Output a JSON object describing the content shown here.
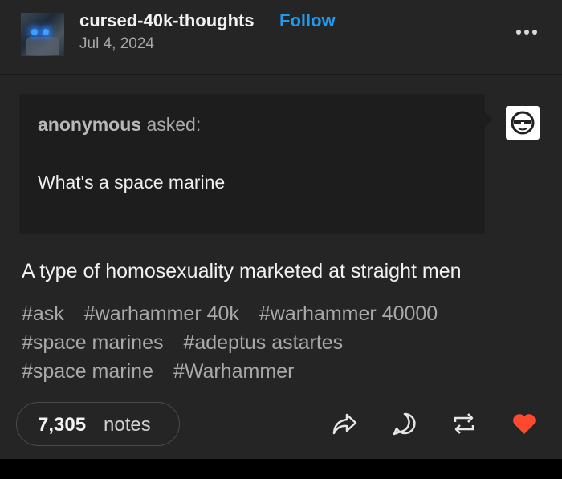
{
  "header": {
    "blog_name": "cursed-40k-thoughts",
    "follow_label": "Follow",
    "date": "Jul 4, 2024",
    "more_icon": "more-options-icon"
  },
  "ask": {
    "asker": "anonymous",
    "asked_suffix": " asked:",
    "question": "What's a space marine",
    "anon_avatar_icon": "anonymous-sunglasses-icon"
  },
  "answer": "A type of homosexuality marketed at straight men",
  "tags": [
    [
      "#ask",
      "#warhammer 40k",
      "#warhammer 40000"
    ],
    [
      "#space marines",
      "#adeptus astartes"
    ],
    [
      "#space marine",
      "#Warhammer"
    ]
  ],
  "footer": {
    "notes_count": "7,305",
    "notes_label": "notes",
    "actions": [
      "share-icon",
      "reply-icon",
      "reblog-icon",
      "like-icon"
    ]
  },
  "colors": {
    "background": "#252525",
    "ask_box": "#1d1d1d",
    "follow": "#1e9bf0",
    "like": "#ff492f"
  }
}
